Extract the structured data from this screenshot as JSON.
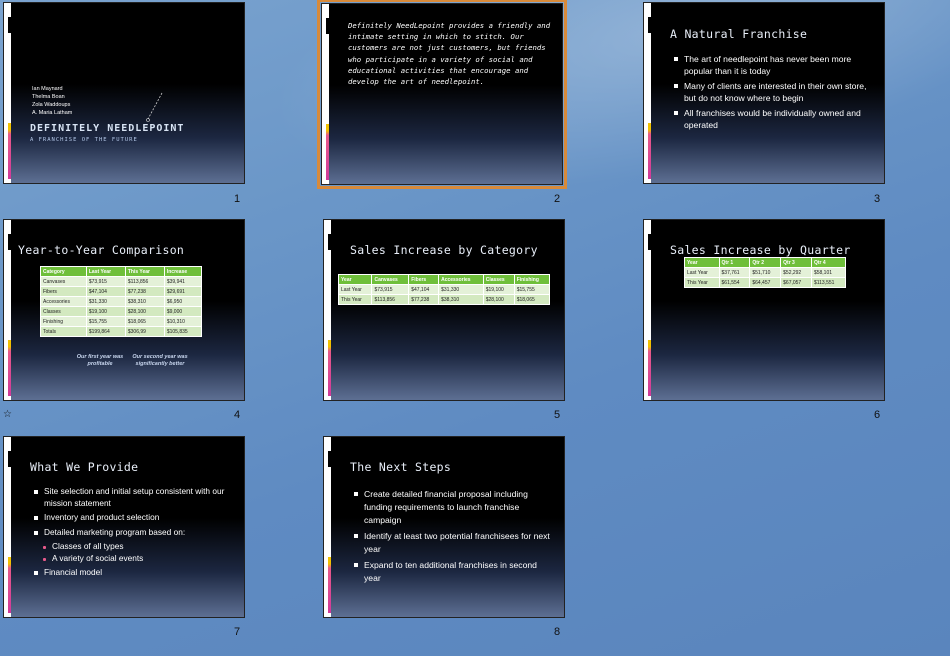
{
  "slides": [
    {
      "number": "1",
      "names": [
        "Ian Maynard",
        "Thelma Boan",
        "Zola Waddoups",
        "A. Maria Latham"
      ],
      "title": "DEFINITELY NEEDLEPOINT",
      "subtitle": "A FRANCHISE OF THE FUTURE"
    },
    {
      "number": "2",
      "quote": "Definitely NeedLepoint provides a friendly and intimate setting in which to stitch. Our customers are not just customers, but friends who participate in a variety of social and educational activities that encourage and develop the art of needlepoint."
    },
    {
      "number": "3",
      "title": "A Natural Franchise",
      "bullets": [
        "The art of needlepoint has never been more popular than it is today",
        "Many of clients are interested in their own store, but do not know where to begin",
        "All franchises would be individually owned and operated"
      ]
    },
    {
      "number": "4",
      "title": "Year-to-Year Comparison",
      "table": {
        "headers": [
          "Category",
          "Last Year",
          "This Year",
          "Increase"
        ],
        "rows": [
          [
            "Canvases",
            "$73,915",
            "$113,856",
            "$39,941"
          ],
          [
            "Fibers",
            "$47,104",
            "$77,238",
            "$29,691"
          ],
          [
            "Accessories",
            "$31,330",
            "$38,310",
            "$6,950"
          ],
          [
            "Classes",
            "$19,100",
            "$28,100",
            "$9,000"
          ],
          [
            "Finishing",
            "$15,755",
            "$18,065",
            "$10,310"
          ],
          [
            "Totals",
            "$199,864",
            "$306,99",
            "$105,835"
          ]
        ]
      },
      "captions": [
        "Our first year was profitable",
        "Our second year was significantly better"
      ]
    },
    {
      "number": "5",
      "title": "Sales Increase by Category",
      "table": {
        "headers": [
          "Year",
          "Canvases",
          "Fibers",
          "Accessories",
          "Classes",
          "Finishing"
        ],
        "rows": [
          [
            "Last Year",
            "$73,915",
            "$47,104",
            "$31,330",
            "$19,100",
            "$15,755"
          ],
          [
            "This Year",
            "$113,856",
            "$77,238",
            "$38,310",
            "$28,100",
            "$18,065"
          ]
        ]
      }
    },
    {
      "number": "6",
      "title": "Sales Increase by Quarter",
      "table": {
        "headers": [
          "Year",
          "Qtr 1",
          "Qtr 2",
          "Qtr 3",
          "Qtr 4"
        ],
        "rows": [
          [
            "Last Year",
            "$37,761",
            "$51,710",
            "$52,292",
            "$58,101"
          ],
          [
            "This Year",
            "$61,554",
            "$64,457",
            "$67,057",
            "$113,551"
          ]
        ]
      }
    },
    {
      "number": "7",
      "title": "What We Provide",
      "bullets": [
        "Site selection and initial setup consistent with our mission statement",
        "Inventory and product selection",
        "Detailed marketing program based on:",
        "Classes of all types",
        "A variety of social events",
        "Financial model"
      ]
    },
    {
      "number": "8",
      "title": "The Next Steps",
      "bullets": [
        "Create detailed financial proposal including funding requirements to launch franchise campaign",
        "Identify at least two potential franchisees for next year",
        "Expand to ten additional franchises in second year"
      ]
    }
  ],
  "transition_icon": "star-transition-icon",
  "colors": {
    "accent_selection": "#d88a3a",
    "table_header": "#6fbf3a",
    "table_cell": "#e4f1d8"
  }
}
